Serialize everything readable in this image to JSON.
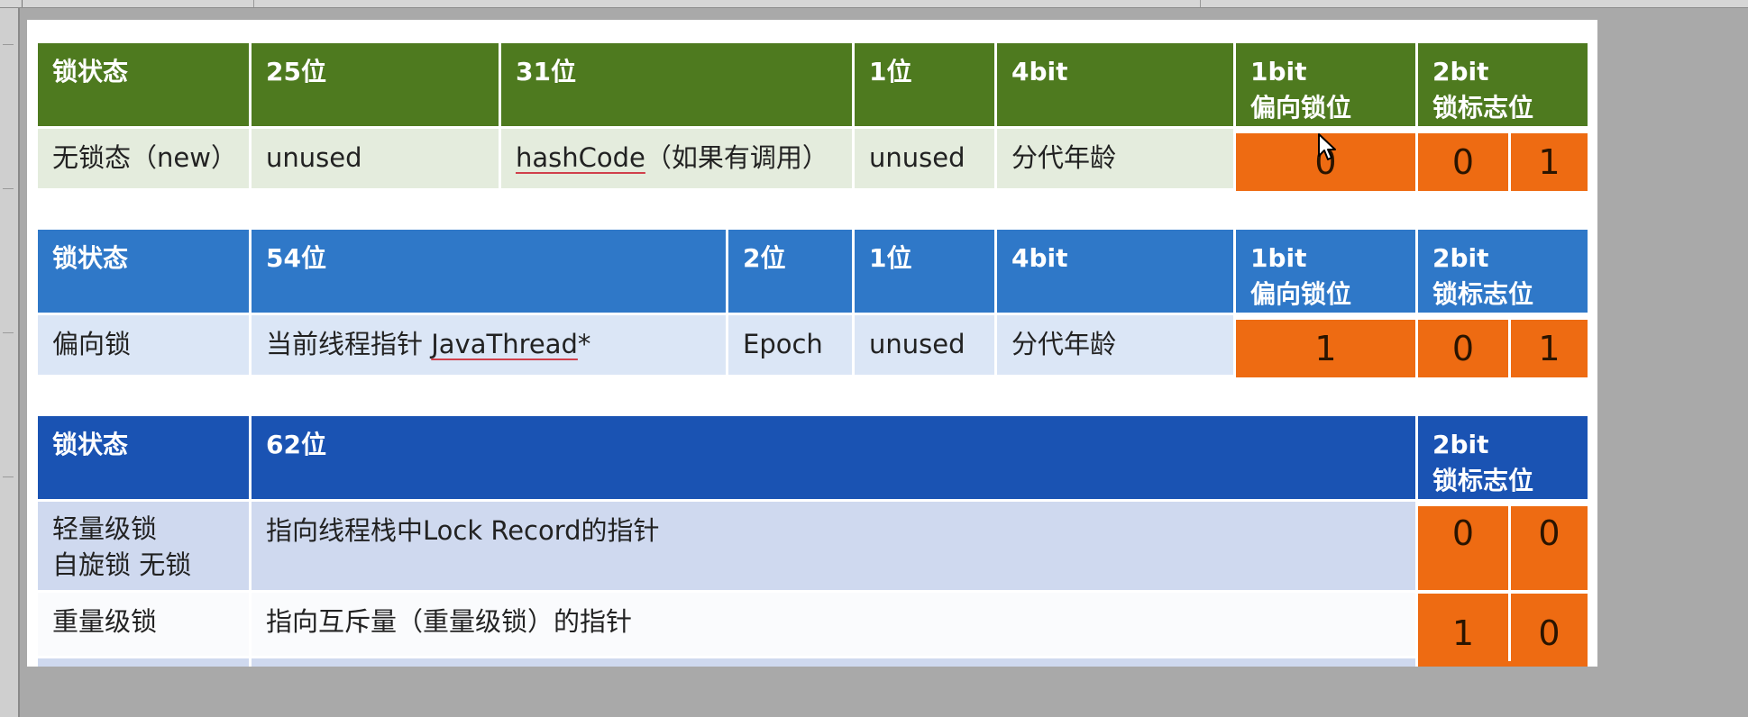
{
  "table1": {
    "headers": [
      "锁状态",
      "25位",
      "31位",
      "1位",
      "4bit",
      "1bit\n偏向锁位",
      "2bit\n锁标志位"
    ],
    "row": {
      "state": "无锁态（new）",
      "c25": "unused",
      "c31_a": "hashCode",
      "c31_b": "（如果有调用）",
      "c1": "unused",
      "c4": "分代年龄",
      "biased": "0",
      "flag1": "0",
      "flag2": "1"
    }
  },
  "table2": {
    "headers": [
      "锁状态",
      "54位",
      "2位",
      "1位",
      "4bit",
      "1bit\n偏向锁位",
      "2bit\n锁标志位"
    ],
    "row": {
      "state": "偏向锁",
      "c54_a": "当前线程指针 ",
      "c54_b": "JavaThread",
      "c54_c": "*",
      "c2": "Epoch",
      "c1": "unused",
      "c4": "分代年龄",
      "biased": "1",
      "flag1": "0",
      "flag2": "1"
    }
  },
  "table3": {
    "headers": [
      "锁状态",
      "62位",
      "2bit\n锁标志位"
    ],
    "rows": [
      {
        "state": "轻量级锁\n自旋锁 无锁",
        "desc": "指向线程栈中Lock Record的指针",
        "flag1": "0",
        "flag2": "0"
      },
      {
        "state": "重量级锁",
        "desc": "指向互斥量（重量级锁）的指针",
        "flag1": "1",
        "flag2": "0"
      }
    ]
  }
}
